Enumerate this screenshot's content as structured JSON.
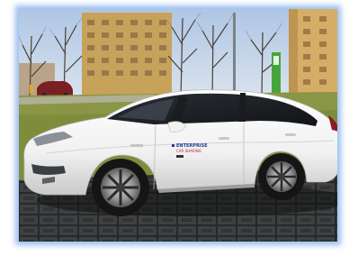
{
  "photo": {
    "door_branding": {
      "line1": "ENTERPRISE",
      "line2": "CAR SHARING"
    },
    "colors": {
      "frame_glow": "#78aaeb",
      "sky": "#c6d6ea",
      "car_body": "#f6f6f6",
      "pavers": "#3c3e40",
      "grass": "#7b8a3a",
      "building_left": "#c8a35a",
      "building_right": "#d8b06a",
      "charger_green": "#46a53a"
    }
  }
}
